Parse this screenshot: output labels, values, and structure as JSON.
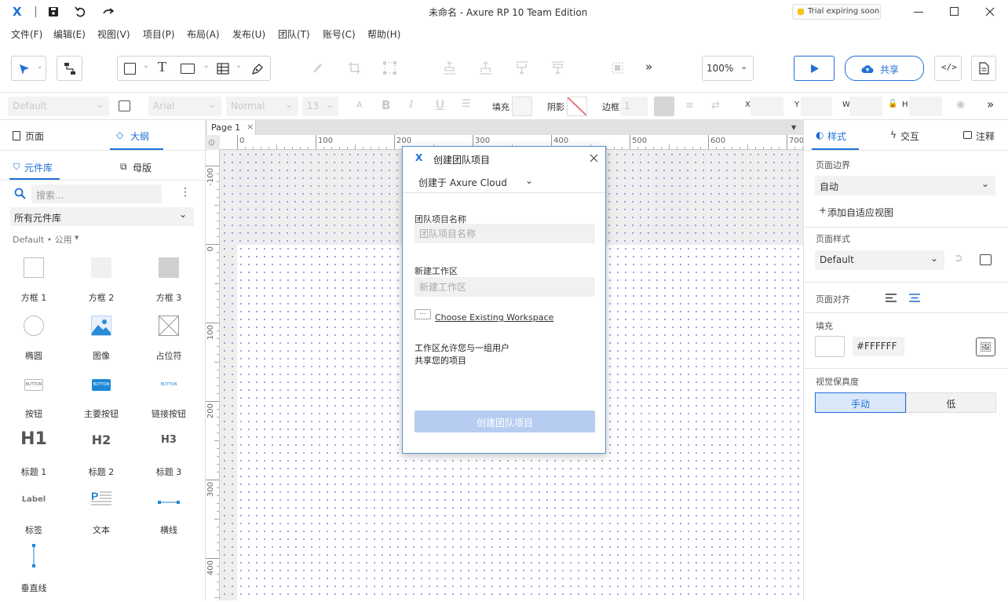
{
  "titlebar": {
    "title": "未命名 - Axure RP 10 Team Edition",
    "trial": "Trial expiring soon"
  },
  "menu": [
    "文件(F)",
    "编辑(E)",
    "视图(V)",
    "项目(P)",
    "布局(A)",
    "发布(U)",
    "团队(T)",
    "账号(C)",
    "帮助(H)"
  ],
  "toolbar": {
    "zoom": "100%",
    "share": "共享"
  },
  "format": {
    "style": "Default",
    "font": "Arial",
    "weight": "Normal",
    "size": "13",
    "fill": "填充",
    "shadow": "阴影",
    "border": "边框",
    "border_val": "1",
    "x": "X",
    "y": "Y",
    "w": "W",
    "h": "H"
  },
  "left": {
    "tab_pages": "页面",
    "tab_outline": "大纲",
    "tab_library": "元件库",
    "tab_masters": "母版",
    "search_placeholder": "搜索...",
    "library_select": "所有元件库",
    "group": "Default • 公用",
    "widgets": [
      {
        "label": "方框 1",
        "icon": "box1-icon"
      },
      {
        "label": "方框 2",
        "icon": "box2-icon"
      },
      {
        "label": "方框 3",
        "icon": "box3-icon"
      },
      {
        "label": "椭圆",
        "icon": "ellipse-icon"
      },
      {
        "label": "图像",
        "icon": "image-icon"
      },
      {
        "label": "占位符",
        "icon": "placeholder-icon"
      },
      {
        "label": "按钮",
        "icon": "button-icon",
        "text": "BUTTON"
      },
      {
        "label": "主要按钮",
        "icon": "primary-button-icon",
        "text": "BUTTON"
      },
      {
        "label": "链接按钮",
        "icon": "link-button-icon",
        "text": "BUTTON"
      },
      {
        "label": "标题 1",
        "icon": "h1-icon",
        "text": "H1"
      },
      {
        "label": "标题 2",
        "icon": "h2-icon",
        "text": "H2"
      },
      {
        "label": "标题 3",
        "icon": "h3-icon",
        "text": "H3"
      },
      {
        "label": "标签",
        "icon": "label-icon",
        "text": "Label"
      },
      {
        "label": "文本",
        "icon": "paragraph-icon"
      },
      {
        "label": "横线",
        "icon": "hline-icon"
      },
      {
        "label": "垂直线",
        "icon": "vline-icon"
      }
    ]
  },
  "canvas": {
    "tab": "Page 1",
    "ruler_h": [
      "0",
      "100",
      "200",
      "300",
      "400",
      "500",
      "600",
      "700"
    ],
    "ruler_v": [
      "-100",
      "0",
      "100",
      "200",
      "300",
      "400"
    ]
  },
  "dialog": {
    "title": "创建团队项目",
    "location": "创建于 Axure Cloud",
    "name_label": "团队项目名称",
    "name_placeholder": "团队项目名称",
    "ws_label": "新建工作区",
    "ws_placeholder": "新建工作区",
    "choose_ws": "Choose Existing Workspace",
    "desc_line1": "工作区允许您与一组用户",
    "desc_line2": "共享您的项目",
    "submit": "创建团队项目"
  },
  "right": {
    "tab_style": "样式",
    "tab_interact": "交互",
    "tab_notes": "注释",
    "page_dim_label": "页面边界",
    "page_dim_value": "自动",
    "add_adaptive": "添加自适应视图",
    "page_style_label": "页面样式",
    "page_style_value": "Default",
    "page_align_label": "页面对齐",
    "fill_label": "填充",
    "fill_value": "#FFFFFF",
    "fidelity_label": "视觉保真度",
    "fidelity_manual": "手动",
    "fidelity_low": "低"
  },
  "colors": {
    "accent": "#1f6fd6",
    "trial": "#f5c518"
  }
}
